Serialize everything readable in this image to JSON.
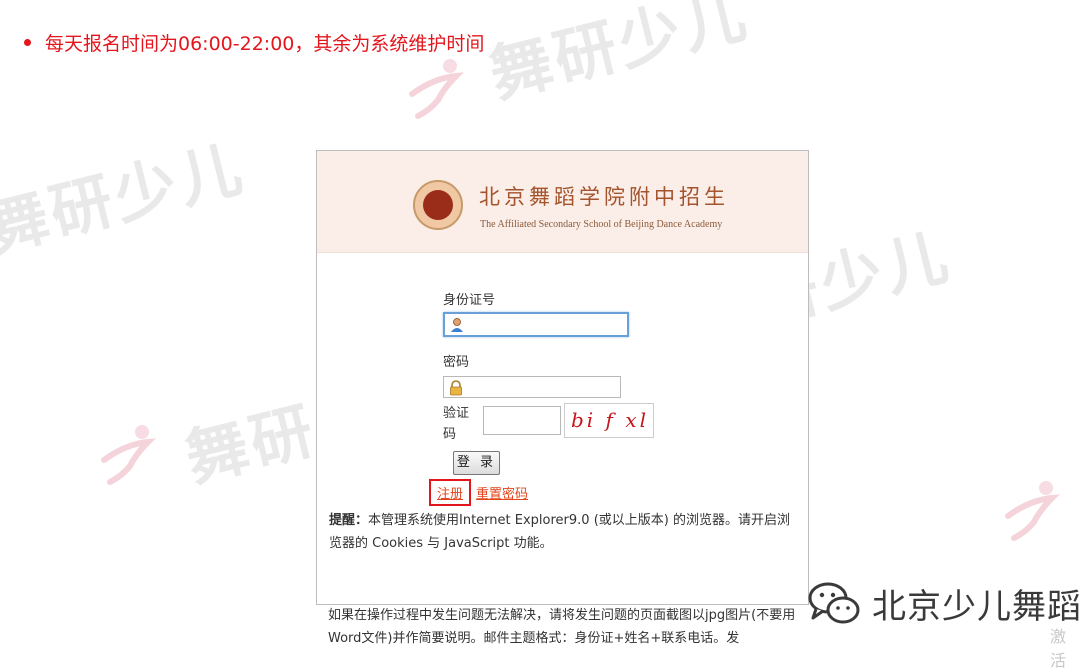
{
  "notice": {
    "text": "每天报名时间为06:00-22:00，其余为系统维护时间"
  },
  "watermark": {
    "text": "舞研少儿"
  },
  "banner": {
    "school_cn": "北京舞蹈学院附中招生",
    "school_en": "The Affiliated Secondary School of Beijing Dance Academy"
  },
  "form": {
    "id_label": "身份证号",
    "password_label": "密码",
    "captcha_label": "验证码",
    "captcha_text": "bi f xl",
    "login_label": "登 录",
    "register_label": "注册",
    "reset_label": "重置密码"
  },
  "tip": {
    "prefix": "提醒：",
    "text": "本管理系统使用Internet Explorer9.0 (或以上版本) 的浏览器。请开启浏览器的 Cookies 与 JavaScript 功能。"
  },
  "footer_note": "如果在操作过程中发生问题无法解决，请将发生问题的页面截图以jpg图片(不要用Word文件)并作简要说明。邮件主题格式：身份证+姓名+联系电话。发",
  "brand": {
    "name": "北京少儿舞蹈",
    "sub": "激活"
  },
  "colors": {
    "notice": "#e4161c",
    "banner_bg": "#fbeee8",
    "school": "#a3542c",
    "link": "#e2461c"
  },
  "icons": {
    "id_field": "user-icon",
    "password_field": "lock-icon",
    "brand": "wechat-icon"
  }
}
